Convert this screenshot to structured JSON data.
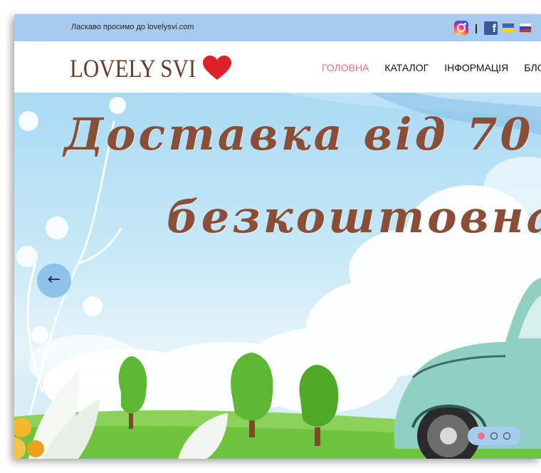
{
  "topbar": {
    "welcome_text": "Ласкаво просимо до lovelysvi.com",
    "separator": "|",
    "icons": [
      "instagram-icon",
      "facebook-icon",
      "flag-ukraine-icon",
      "flag-russia-icon"
    ]
  },
  "header": {
    "logo_text": "LOVELY SVI",
    "logo_icon": "heart-icon",
    "nav": [
      {
        "label": "ГОЛОВНА",
        "active": true
      },
      {
        "label": "КАТАЛОГ",
        "active": false
      },
      {
        "label": "ІНФОРМАЦІЯ",
        "active": false
      },
      {
        "label": "БЛОГ",
        "active": false
      }
    ]
  },
  "hero": {
    "headline_line1": "Доставка від 70",
    "headline_line2": "безкоштовна",
    "prev_arrow": "←",
    "slide_count": 3,
    "active_slide": 1
  },
  "colors": {
    "topbar_bg": "#a7cbee",
    "nav_active": "#e8718a",
    "logo_text": "#6b3a2a",
    "headline": "#8a4d36",
    "heart": "#e0202a",
    "dot_active": "#f0728d"
  }
}
